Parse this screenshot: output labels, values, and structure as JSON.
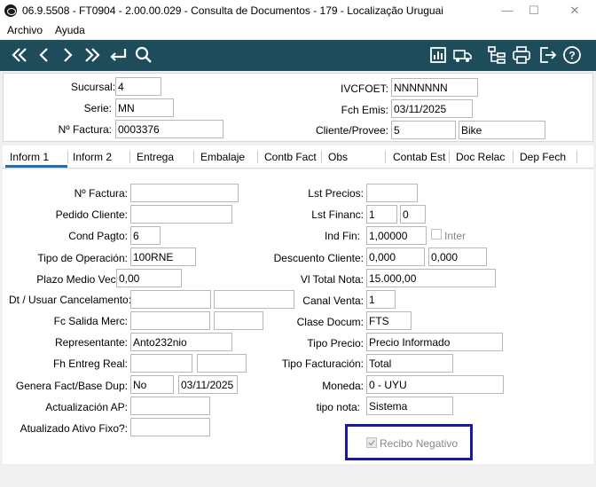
{
  "window": {
    "title": "06.9.5508 - FT0904 - 2.00.00.029 - Consulta de Documentos - 179 - Localização Uruguai",
    "minimize": "—",
    "maximize": "☐",
    "close": "✕"
  },
  "menu": {
    "items": [
      "Archivo",
      "Ayuda"
    ]
  },
  "toolbar": {
    "nav_icons": [
      "first-icon",
      "previous-icon",
      "next-icon",
      "last-icon",
      "return-icon",
      "search-icon"
    ],
    "action_icons": [
      "report-icon",
      "delivery-truck-icon",
      "tree-icon",
      "print-icon",
      "exit-icon",
      "help-icon"
    ],
    "color": "#1e4c5a"
  },
  "header": {
    "sucursal_label": "Sucursal:",
    "sucursal_value": "4",
    "serie_label": "Serie:",
    "serie_value": "MN",
    "nfactura_label": "Nº Factura:",
    "nfactura_value": "0003376",
    "ivcfoet_label": "IVCFOET:",
    "ivcfoet_value": "NNNNNNN",
    "fch_emis_label": "Fch Emis:",
    "fch_emis_value": "03/11/2025",
    "cliente_label": "Cliente/Provee:",
    "cliente_code": "5",
    "cliente_name": "Bike"
  },
  "tabs": [
    "Inform 1",
    "Inform 2",
    "Entrega",
    "Embalaje",
    "Contb Fact",
    "Obs",
    "Contab Est",
    "Doc Relac",
    "Dep Fech"
  ],
  "form": {
    "nfactura_label": "Nº Factura:",
    "nfactura_value": "",
    "pedido_label": "Pedido Cliente:",
    "pedido_value": "",
    "cond_pagto_label": "Cond Pagto:",
    "cond_pagto_value": "6",
    "tipo_op_label": "Tipo de Operación:",
    "tipo_op_value": "100RNE",
    "plazo_label": "Plazo Medio Vecto:",
    "plazo_value": "0,00",
    "dt_cancel_label": "Dt / Usuar Cancelamento:",
    "fc_salida_label": "Fc Salida Merc:",
    "representante_label": "Representante:",
    "representante_value": "Anto232nio",
    "fh_entreg_label": "Fh Entreg Real:",
    "genera_label": "Genera Fact/Base Dup:",
    "genera_value": "No",
    "genera_date": "03/11/2025",
    "actualizacion_label": "Actualización AP:",
    "atualizado_label": "Atualizado Ativo Fixo?:",
    "lst_precios_label": "Lst Precios:",
    "lst_precios_value": "",
    "lst_financ_label": "Lst Financ:",
    "lst_financ_value1": "1",
    "lst_financ_value2": "0",
    "ind_fin_label": "Ind Fin:",
    "ind_fin_value": "1,00000",
    "inter_label": "Inter",
    "descuento_label": "Descuento Cliente:",
    "descuento_value1": "0,000",
    "descuento_value2": "0,000",
    "vl_total_label": "Vl Total Nota:",
    "vl_total_value": "15.000,00",
    "canal_label": "Canal Venta:",
    "canal_value": "1",
    "clase_label": "Clase Docum:",
    "clase_value": "FTS",
    "tipo_precio_label": "Tipo Precio:",
    "tipo_precio_value": "Precio Informado",
    "tipo_fact_label": "Tipo Facturación:",
    "tipo_fact_value": "Total",
    "moneda_label": "Moneda:",
    "moneda_value": "0 - UYU",
    "tipo_nota_label": "tipo nota:",
    "tipo_nota_value": "Sistema",
    "recibo_label": "Recibo Negativo",
    "highlight_color": "#1a1aa0"
  }
}
